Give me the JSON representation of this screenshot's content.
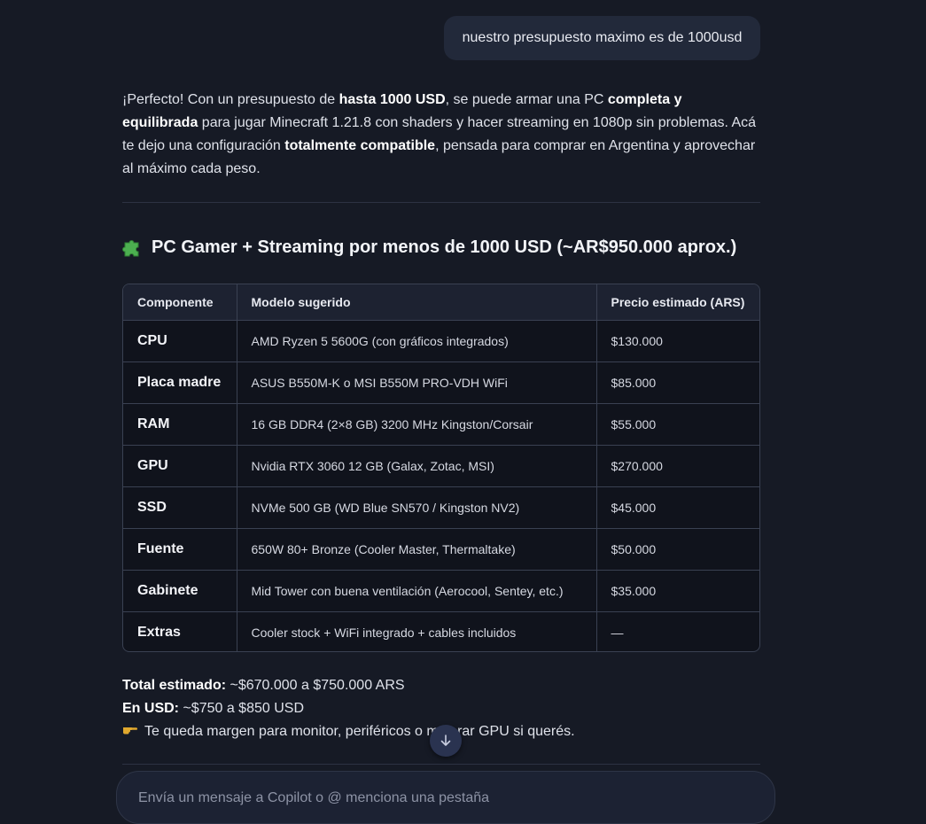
{
  "user_message": "nuestro presupuesto maximo es de 1000usd",
  "reply": {
    "p1": "¡Perfecto! Con un presupuesto de ",
    "b1": "hasta 1000 USD",
    "p2": ", se puede armar una PC ",
    "b2": "completa y equilibrada",
    "p3": " para jugar Minecraft 1.21.8 con shaders y hacer streaming en 1080p sin problemas. Acá te dejo una configuración ",
    "b3": "totalmente compatible",
    "p4": ", pensada para comprar en Argentina y aprovechar al máximo cada peso."
  },
  "section_title": "PC Gamer + Streaming por menos de 1000 USD (~AR$950.000 aprox.)",
  "section_icon": "puzzle-piece-icon",
  "table": {
    "headers": [
      "Componente",
      "Modelo sugerido",
      "Precio estimado (ARS)"
    ],
    "rows": [
      [
        "CPU",
        "AMD Ryzen 5 5600G (con gráficos integrados)",
        "$130.000"
      ],
      [
        "Placa madre",
        "ASUS B550M-K o MSI B550M PRO-VDH WiFi",
        "$85.000"
      ],
      [
        "RAM",
        "16 GB DDR4 (2×8 GB) 3200 MHz Kingston/Corsair",
        "$55.000"
      ],
      [
        "GPU",
        "Nvidia RTX 3060 12 GB (Galax, Zotac, MSI)",
        "$270.000"
      ],
      [
        "SSD",
        "NVMe 500 GB (WD Blue SN570 / Kingston NV2)",
        "$45.000"
      ],
      [
        "Fuente",
        "650W 80+ Bronze (Cooler Master, Thermaltake)",
        "$50.000"
      ],
      [
        "Gabinete",
        "Mid Tower con buena ventilación (Aerocool, Sentey, etc.)",
        "$35.000"
      ],
      [
        "Extras",
        "Cooler stock + WiFi integrado + cables incluidos",
        "—"
      ]
    ]
  },
  "totals": {
    "total_label": "Total estimado:",
    "total_value": " ~$670.000 a $750.000 ARS",
    "usd_label": "En USD:",
    "usd_value": " ~$750 a $850 USD",
    "note": "Te queda margen para monitor, periféricos o mejorar GPU si querés.",
    "note_icon": "pointing-hand-icon"
  },
  "composer": {
    "placeholder": "Envía un mensaje a Copilot o @ menciona una pestaña"
  },
  "colors": {
    "background": "#161a25",
    "bubble": "#22293a",
    "table_header": "#1d2231",
    "border": "#3a4152"
  }
}
